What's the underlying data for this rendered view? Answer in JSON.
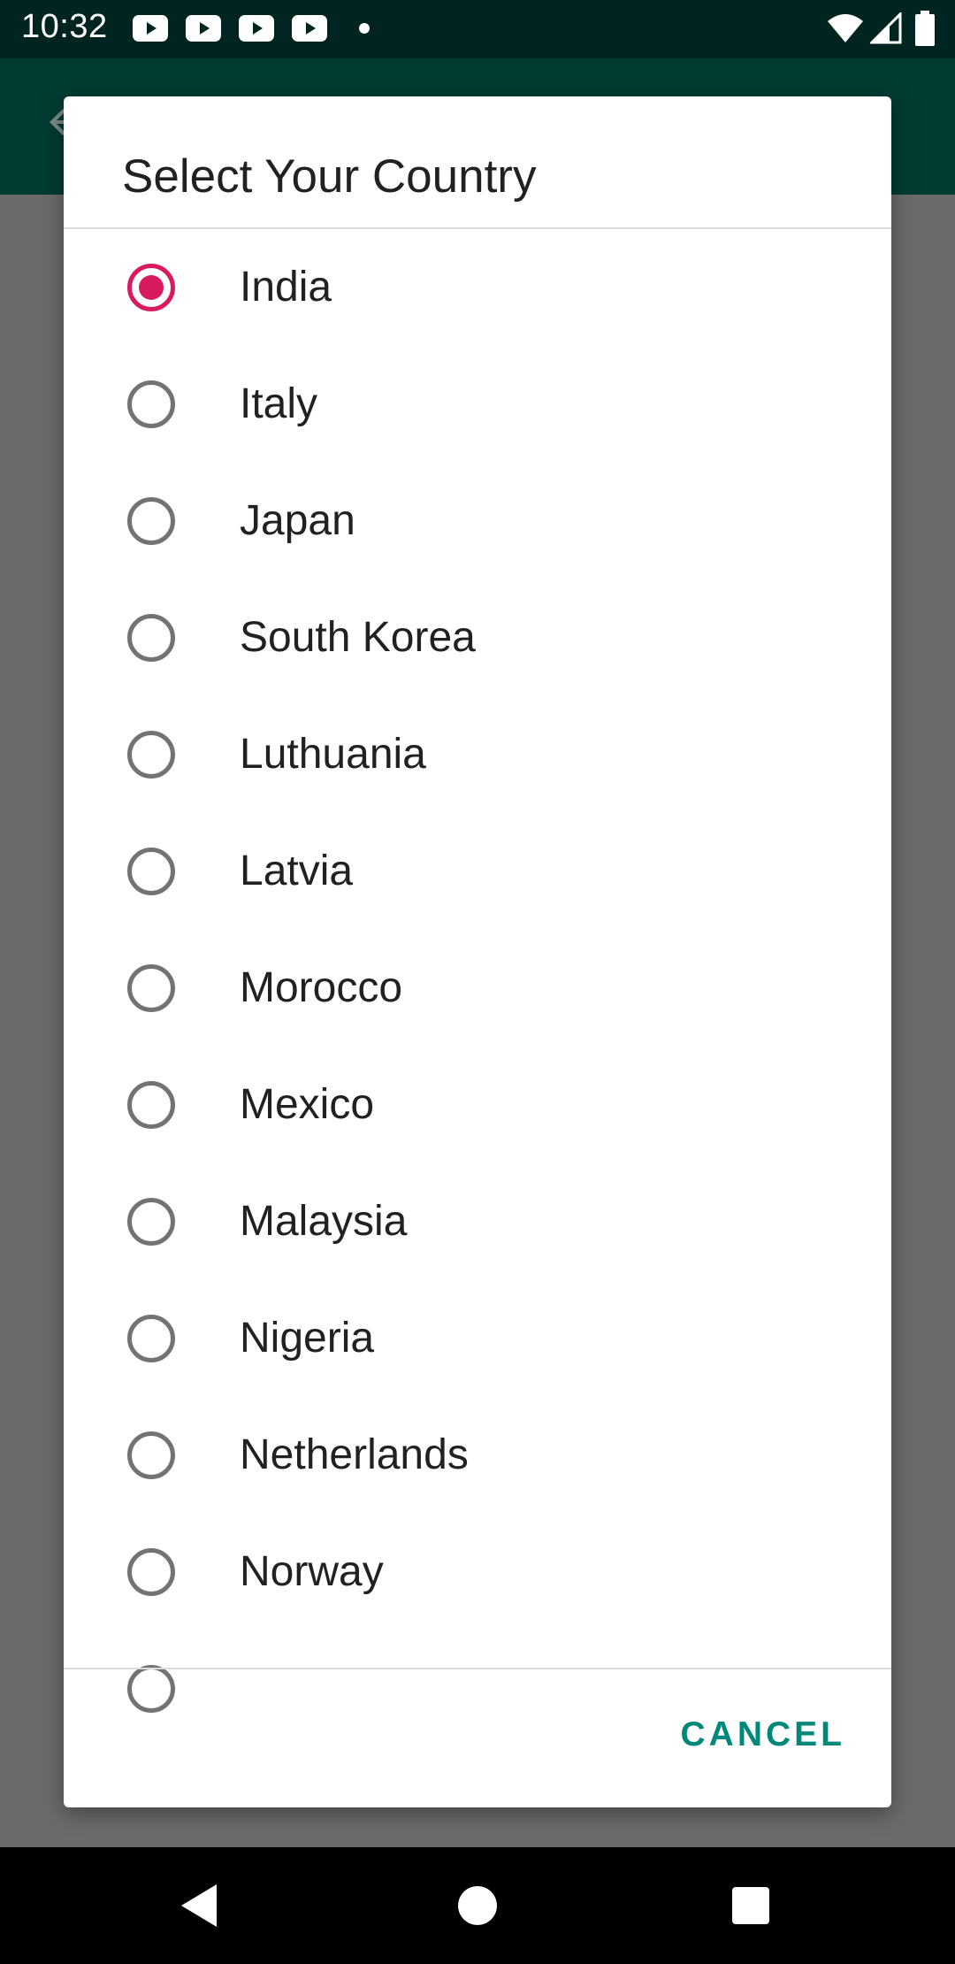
{
  "status_bar": {
    "time": "10:32",
    "notification_icons": [
      "youtube-icon",
      "youtube-icon",
      "youtube-icon",
      "youtube-icon"
    ],
    "indicators": [
      "wifi-icon",
      "cellular-signal-icon",
      "battery-icon"
    ]
  },
  "dialog": {
    "title": "Select Your Country",
    "options": [
      {
        "label": "India",
        "selected": true
      },
      {
        "label": "Italy",
        "selected": false
      },
      {
        "label": "Japan",
        "selected": false
      },
      {
        "label": "South Korea",
        "selected": false
      },
      {
        "label": "Luthuania",
        "selected": false
      },
      {
        "label": "Latvia",
        "selected": false
      },
      {
        "label": "Morocco",
        "selected": false
      },
      {
        "label": "Mexico",
        "selected": false
      },
      {
        "label": "Malaysia",
        "selected": false
      },
      {
        "label": "Nigeria",
        "selected": false
      },
      {
        "label": "Netherlands",
        "selected": false
      },
      {
        "label": "Norway",
        "selected": false
      }
    ],
    "cancel_label": "CANCEL"
  },
  "colors": {
    "accent": "#d81b60",
    "button_text": "#00897b",
    "app_bar": "#003b31",
    "status_bar": "#002520"
  },
  "nav_bar": {
    "buttons": [
      "back-icon",
      "home-icon",
      "recents-icon"
    ]
  }
}
